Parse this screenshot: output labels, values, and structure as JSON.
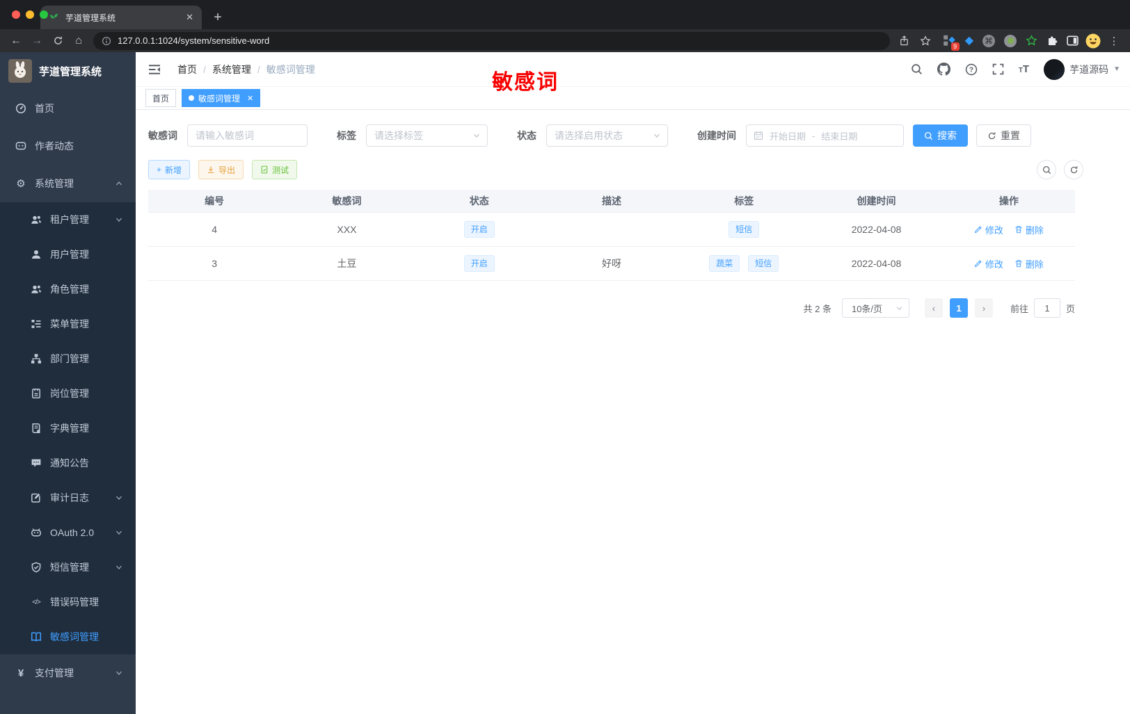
{
  "browser": {
    "tab_title": "芋道管理系统",
    "url": "127.0.0.1:1024/system/sensitive-word",
    "ext_badge": "9"
  },
  "annotation": "敏感词",
  "sidebar": {
    "app_title": "芋道管理系统",
    "items": [
      {
        "label": "首页"
      },
      {
        "label": "作者动态"
      },
      {
        "label": "系统管理"
      },
      {
        "label": "租户管理"
      },
      {
        "label": "用户管理"
      },
      {
        "label": "角色管理"
      },
      {
        "label": "菜单管理"
      },
      {
        "label": "部门管理"
      },
      {
        "label": "岗位管理"
      },
      {
        "label": "字典管理"
      },
      {
        "label": "通知公告"
      },
      {
        "label": "审计日志"
      },
      {
        "label": "OAuth 2.0"
      },
      {
        "label": "短信管理"
      },
      {
        "label": "错误码管理"
      },
      {
        "label": "敏感词管理"
      },
      {
        "label": "支付管理"
      }
    ]
  },
  "header": {
    "breadcrumb": [
      "首页",
      "系统管理",
      "敏感词管理"
    ],
    "user_name": "芋道源码"
  },
  "tags_view": {
    "home": "首页",
    "active": "敏感词管理"
  },
  "filters": {
    "keyword_label": "敏感词",
    "keyword_placeholder": "请输入敏感词",
    "tag_label": "标签",
    "tag_placeholder": "请选择标签",
    "status_label": "状态",
    "status_placeholder": "请选择启用状态",
    "date_label": "创建时间",
    "date_start": "开始日期",
    "date_separator": "-",
    "date_end": "结束日期",
    "search_label": "搜索",
    "reset_label": "重置"
  },
  "toolbar": {
    "add_label": "新增",
    "export_label": "导出",
    "test_label": "测试"
  },
  "table": {
    "columns": [
      "编号",
      "敏感词",
      "状态",
      "描述",
      "标签",
      "创建时间",
      "操作"
    ],
    "edit_label": "修改",
    "delete_label": "删除",
    "rows": [
      {
        "id": "4",
        "word": "XXX",
        "status": "开启",
        "description": "",
        "tags": [
          "短信"
        ],
        "created_at": "2022-04-08"
      },
      {
        "id": "3",
        "word": "土豆",
        "status": "开启",
        "description": "好呀",
        "tags": [
          "蔬菜",
          "短信"
        ],
        "created_at": "2022-04-08"
      }
    ]
  },
  "pagination": {
    "total": "共 2 条",
    "page_size": "10条/页",
    "current_page": "1",
    "goto_label": "前往",
    "goto_value": "1",
    "unit_label": "页"
  },
  "colors": {
    "accent": "#409eff",
    "annotation_red": "#f70000",
    "warning": "#e6a23c",
    "success": "#67c23a",
    "sidebar_bg": "#2f3a4b",
    "submenu_bg": "#1f2d3d"
  }
}
